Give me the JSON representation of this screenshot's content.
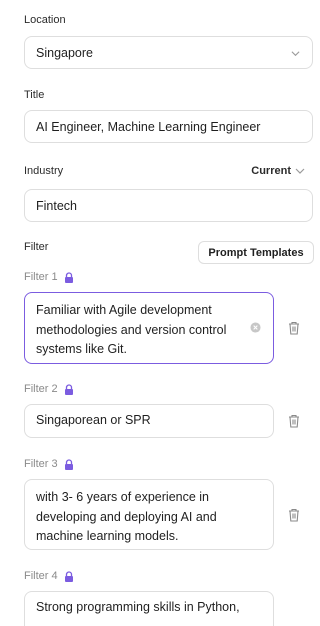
{
  "location": {
    "label": "Location",
    "value": "Singapore"
  },
  "title": {
    "label": "Title",
    "value": "AI Engineer, Machine Learning Engineer"
  },
  "industry": {
    "label": "Industry",
    "mode": "Current",
    "value": "Fintech"
  },
  "filter": {
    "label": "Filter",
    "prompt_templates_label": "Prompt Templates",
    "accent_color": "#7b5ce0",
    "items": [
      {
        "label": "Filter 1",
        "text": "Familiar with Agile development methodologies and version control systems like Git."
      },
      {
        "label": "Filter 2",
        "text": "Singaporean or SPR"
      },
      {
        "label": "Filter 3",
        "text": "with 3- 6 years of experience in developing and deploying AI and machine learning models."
      },
      {
        "label": "Filter 4",
        "text": "Strong programming skills in Python,"
      }
    ]
  }
}
